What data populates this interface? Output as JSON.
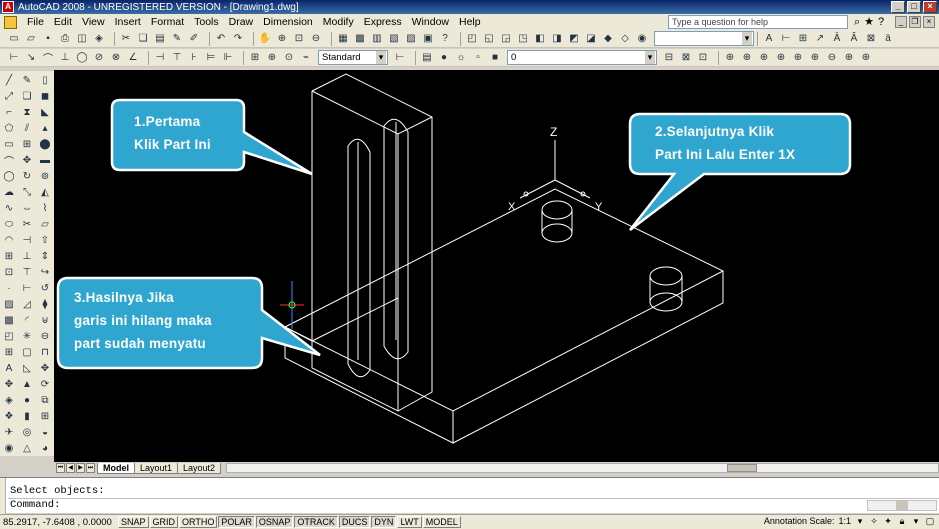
{
  "window": {
    "title": "AutoCAD 2008 - UNREGISTERED VERSION - [Drawing1.dwg]",
    "app_icon": "autocad-logo-icon"
  },
  "menu": {
    "items": [
      "File",
      "Edit",
      "View",
      "Insert",
      "Format",
      "Tools",
      "Draw",
      "Dimension",
      "Modify",
      "Express",
      "Window",
      "Help"
    ],
    "help_placeholder": "Type a question for help"
  },
  "toolbar": {
    "text_style": "Standard",
    "layer": "0"
  },
  "callouts": [
    {
      "lines": [
        "1.Pertama",
        "Klik Part Ini"
      ]
    },
    {
      "lines": [
        "2.Selanjutnya Klik",
        "Part Ini Lalu Enter 1X"
      ]
    },
    {
      "lines": [
        "3.Hasilnya Jika",
        "garis ini hilang maka",
        "part sudah menyatu"
      ]
    }
  ],
  "ucs": {
    "z": "Z",
    "x": "X",
    "y": "Y"
  },
  "tabs": [
    "Model",
    "Layout1",
    "Layout2"
  ],
  "command": {
    "history": "Select objects:",
    "prompt": "Command:"
  },
  "status": {
    "coords": "85.2917, -7.6408 , 0.0000",
    "buttons": [
      "SNAP",
      "GRID",
      "ORTHO",
      "POLAR",
      "OSNAP",
      "OTRACK",
      "DUCS",
      "DYN",
      "LWT",
      "MODEL"
    ],
    "annotation_scale_label": "Annotation Scale:",
    "annotation_scale_value": "1:1"
  },
  "colors": {
    "callout_fill": "#2fa6cf",
    "callout_stroke": "#ffffff",
    "viewport_bg": "#000000",
    "model_lines": "#ffffff"
  }
}
